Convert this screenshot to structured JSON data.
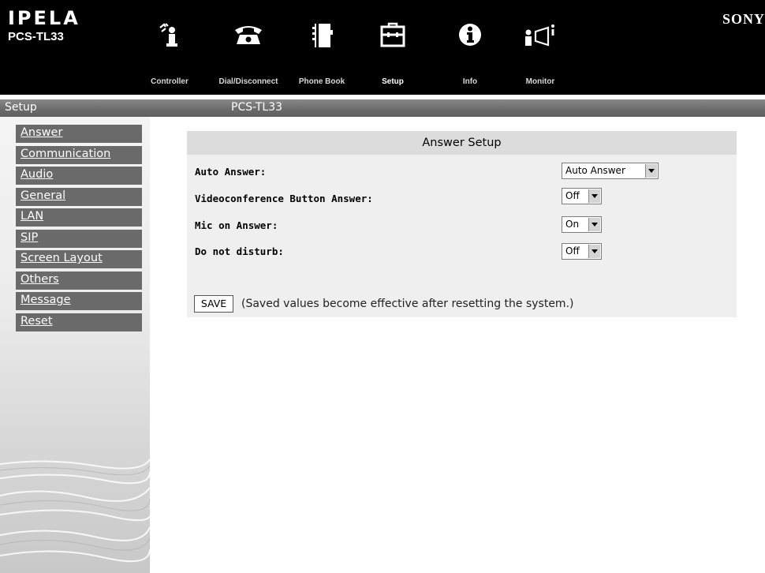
{
  "header": {
    "brand": "IPELA",
    "model": "PCS-TL33",
    "vendor": "SONY",
    "nav": [
      {
        "label": "Controller",
        "icon": "controller-icon"
      },
      {
        "label": "Dial/Disconnect",
        "icon": "phone-icon"
      },
      {
        "label": "Phone Book",
        "icon": "phone-book-icon"
      },
      {
        "label": "Setup",
        "icon": "toolbox-icon",
        "active": true
      },
      {
        "label": "Info",
        "icon": "info-icon"
      },
      {
        "label": "Monitor",
        "icon": "monitor-icon"
      }
    ]
  },
  "titlebar": {
    "section": "Setup",
    "device": "PCS-TL33"
  },
  "sidebar": {
    "items": [
      {
        "label": "Answer"
      },
      {
        "label": "Communication"
      },
      {
        "label": "Audio"
      },
      {
        "label": "General"
      },
      {
        "label": "LAN"
      },
      {
        "label": "SIP"
      },
      {
        "label": "Screen Layout"
      },
      {
        "label": "Others"
      },
      {
        "label": "Message"
      },
      {
        "label": "Reset"
      }
    ]
  },
  "main": {
    "title": "Answer Setup",
    "fields": [
      {
        "label": "Auto Answer:",
        "value": "Auto Answer"
      },
      {
        "label": "Videoconference Button Answer:",
        "value": "Off"
      },
      {
        "label": "Mic on Answer:",
        "value": "On"
      },
      {
        "label": "Do not disturb:",
        "value": "Off"
      }
    ],
    "save_label": "SAVE",
    "save_note": "(Saved values become effective after resetting the system.)"
  },
  "colors": {
    "header_bg": "#000000",
    "titlebar_bg": "#6c6c6c",
    "menu_item_bg": "#6a6a6a",
    "panel_head_bg": "#dcdcdc",
    "panel_body_bg": "#efefef"
  }
}
